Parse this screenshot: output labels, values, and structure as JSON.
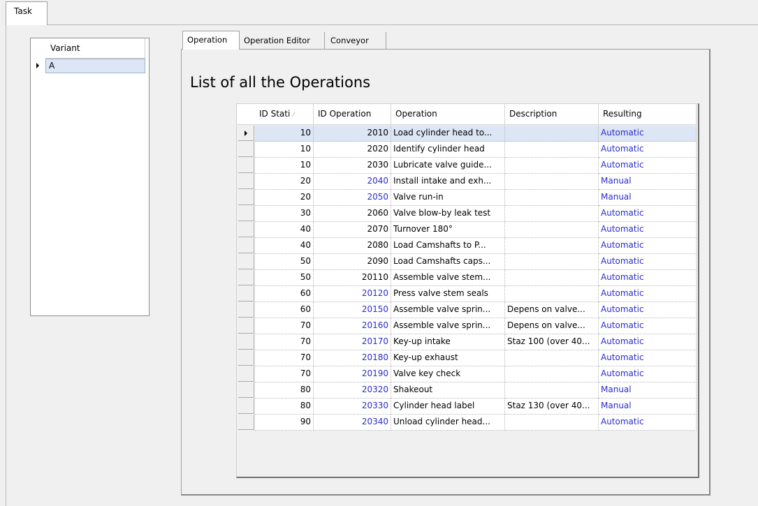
{
  "outer_tab": {
    "label": "Task"
  },
  "variant": {
    "header": "Variant",
    "rows": [
      "A"
    ]
  },
  "tabs": [
    {
      "label": "Operation"
    },
    {
      "label": "Operation Editor"
    },
    {
      "label": "Conveyor"
    }
  ],
  "page_title": "List of all the Operations",
  "grid": {
    "columns": [
      "ID Stati",
      "ID Operation",
      "Operation",
      "Description",
      "Resulting"
    ],
    "sort_glyph": "⁄",
    "rows": [
      {
        "station": "10",
        "id_operation": "2010",
        "operation": "Load cylinder head to...",
        "description": "",
        "resulting": "Automatic",
        "id_link": false
      },
      {
        "station": "10",
        "id_operation": "2020",
        "operation": "Identify cylinder head",
        "description": "",
        "resulting": "Automatic",
        "id_link": false
      },
      {
        "station": "10",
        "id_operation": "2030",
        "operation": "Lubricate valve guide...",
        "description": "",
        "resulting": "Automatic",
        "id_link": false
      },
      {
        "station": "20",
        "id_operation": "2040",
        "operation": "Install intake and exh...",
        "description": "",
        "resulting": "Manual",
        "id_link": true
      },
      {
        "station": "20",
        "id_operation": "2050",
        "operation": "Valve run-in",
        "description": "",
        "resulting": "Manual",
        "id_link": true
      },
      {
        "station": "30",
        "id_operation": "2060",
        "operation": "Valve blow-by leak test",
        "description": "",
        "resulting": "Automatic",
        "id_link": false
      },
      {
        "station": "40",
        "id_operation": "2070",
        "operation": "Turnover 180°",
        "description": "",
        "resulting": "Automatic",
        "id_link": false
      },
      {
        "station": "40",
        "id_operation": "2080",
        "operation": "Load Camshafts to P...",
        "description": "",
        "resulting": "Automatic",
        "id_link": false
      },
      {
        "station": "50",
        "id_operation": "2090",
        "operation": "Load Camshafts caps...",
        "description": "",
        "resulting": "Automatic",
        "id_link": false
      },
      {
        "station": "50",
        "id_operation": "20110",
        "operation": "Assemble valve stem...",
        "description": "",
        "resulting": "Automatic",
        "id_link": false
      },
      {
        "station": "60",
        "id_operation": "20120",
        "operation": "Press valve stem seals",
        "description": "",
        "resulting": "Automatic",
        "id_link": true
      },
      {
        "station": "60",
        "id_operation": "20150",
        "operation": "Assemble valve sprin...",
        "description": "Depens on valve...",
        "resulting": "Automatic",
        "id_link": true
      },
      {
        "station": "70",
        "id_operation": "20160",
        "operation": "Assemble valve sprin...",
        "description": "Depens on valve...",
        "resulting": "Automatic",
        "id_link": true
      },
      {
        "station": "70",
        "id_operation": "20170",
        "operation": "Key-up intake",
        "description": "Staz 100 (over 40...",
        "resulting": "Automatic",
        "id_link": true
      },
      {
        "station": "70",
        "id_operation": "20180",
        "operation": "Key-up exhaust",
        "description": "",
        "resulting": "Automatic",
        "id_link": true
      },
      {
        "station": "70",
        "id_operation": "20190",
        "operation": "Valve key check",
        "description": "",
        "resulting": "Automatic",
        "id_link": true
      },
      {
        "station": "80",
        "id_operation": "20320",
        "operation": "Shakeout",
        "description": "",
        "resulting": "Manual",
        "id_link": true
      },
      {
        "station": "80",
        "id_operation": "20330",
        "operation": "Cylinder head label",
        "description": "Staz 130 (over 40...",
        "resulting": "Manual",
        "id_link": true
      },
      {
        "station": "90",
        "id_operation": "20340",
        "operation": "Unload cylinder head...",
        "description": "",
        "resulting": "Automatic",
        "id_link": true
      }
    ]
  },
  "colors": {
    "link_blue": "#2b2bcc",
    "selection": "#dce6f4",
    "background": "#f0f0f0"
  }
}
